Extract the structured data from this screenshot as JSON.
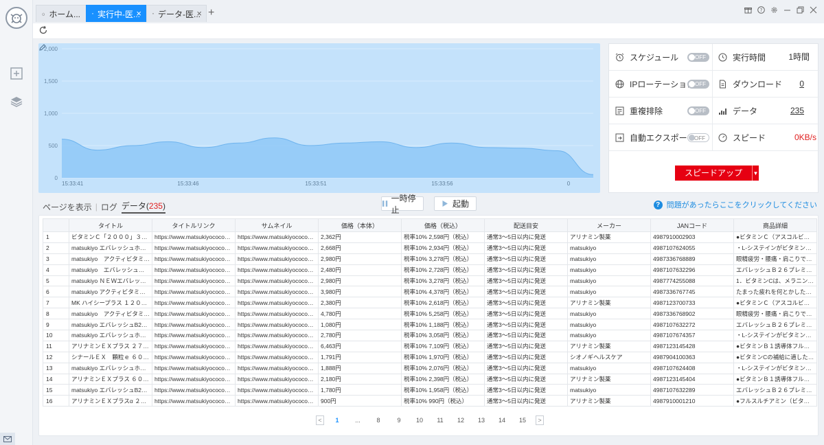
{
  "tabs": [
    {
      "label": "ホーム..."
    },
    {
      "label": "実行中-医..."
    },
    {
      "label": "データ-医..."
    }
  ],
  "chart_data": {
    "type": "area",
    "x": [
      "15:33:41",
      "15:33:46",
      "15:33:51",
      "15:33:56",
      "0"
    ],
    "ylim": [
      0,
      2000
    ],
    "yticks": [
      "2,000",
      "1,500",
      "1,000",
      "500",
      "0"
    ],
    "xticks": [
      "15:33:41",
      "15:33:46",
      "15:33:51",
      "15:33:56",
      "0"
    ],
    "values": [
      600,
      430,
      500,
      560,
      470,
      540,
      620,
      500,
      540,
      560,
      470,
      540,
      470,
      460,
      420,
      50
    ],
    "grid": true,
    "color": "#8cc7f7"
  },
  "stats": {
    "schedule": {
      "label": "スケジュール",
      "state": "OFF"
    },
    "runtime": {
      "label": "実行時間",
      "value": "1時間"
    },
    "ip_rotation": {
      "label": "IPローテーション",
      "state": "OFF"
    },
    "download": {
      "label": "ダウンロード",
      "value": "0"
    },
    "dedupe": {
      "label": "重複排除",
      "state": "OFF"
    },
    "data": {
      "label": "データ",
      "value": "235"
    },
    "auto_export": {
      "label": "自動エクスポート",
      "state": "OFF"
    },
    "speed": {
      "label": "スピード",
      "value": "0KB/s"
    },
    "speedup_label": "スピードアップ"
  },
  "data_tabs": {
    "show_page": "ページを表示",
    "log": "ログ",
    "data_label": "データ(",
    "data_count": "235",
    "data_close": ")"
  },
  "controls": {
    "pause": "一時停止",
    "start": "起動"
  },
  "help_text": "問題があったらここをクリックしてください",
  "table": {
    "headers": [
      "",
      "タイトル",
      "タイトルリンク",
      "サムネイル",
      "価格（本体）",
      "価格（税込）",
      "配送目安",
      "メーカー",
      "JANコード",
      "商品詳細"
    ],
    "rows": [
      [
        "1",
        "ビタミンＣ「２０００」３００...",
        "https://www.matsukiyococokara-...",
        "https://www.matsukiyococokara-...",
        "2,362円",
        "税率10% 2,598円（税込）",
        "通常3～5日以内に発送",
        "アリナミン製薬",
        "4987910002903",
        "●ビタミンＣ（アスコルビン酸..."
      ],
      [
        "2",
        "matsukiyo エバレッシュホワイ...",
        "https://www.matsukiyococokara-...",
        "https://www.matsukiyococokara-...",
        "2,668円",
        "税率10% 2,934円（税込）",
        "通常3～5日以内に発送",
        "matsukiyo",
        "4987107624055",
        "・L-システインがビタミンC、..."
      ],
      [
        "3",
        "matsukiyo　アクティビタミンＥ...",
        "https://www.matsukiyococokara-...",
        "https://www.matsukiyococokara-...",
        "2,980円",
        "税率10% 3,278円（税込）",
        "通常3～5日以内に発送",
        "matsukiyo",
        "4987336768889",
        "眼精疲労・腰痛・肩こりでお悩..."
      ],
      [
        "4",
        "matsukiyo　エバレッシュＢ２６...",
        "https://www.matsukiyococokara-...",
        "https://www.matsukiyococokara-...",
        "2,480円",
        "税率10% 2,728円（税込）",
        "通常3～5日以内に発送",
        "matsukiyo",
        "4987107632296",
        "エバレッシュＢ２６プレミアム..."
      ],
      [
        "5",
        "matsukiyo ＮＥＷエバレッシュ...",
        "https://www.matsukiyococokara-...",
        "https://www.matsukiyococokara-...",
        "2,980円",
        "税率10% 3,278円（税込）",
        "通常3～5日以内に発送",
        "matsukiyo",
        "4987774255088",
        "1．ビタミンCは、メラニンの生..."
      ],
      [
        "6",
        "matsukiyo アクティビタミンＧ...",
        "https://www.matsukiyococokara-...",
        "https://www.matsukiyococokara-...",
        "3,980円",
        "税率10% 4,378円（税込）",
        "通常3～5日以内に発送",
        "matsukiyo",
        "4987336767745",
        "たまった疲れを何とかしたい方..."
      ],
      [
        "7",
        "MK ハイシープラス １２０錠 ア...",
        "https://www.matsukiyococokara-...",
        "https://www.matsukiyococokara-...",
        "2,380円",
        "税率10% 2,618円（税込）",
        "通常3～5日以内に発送",
        "アリナミン製薬",
        "4987123700733",
        "●ビタミンＣ（アスコルビン酸）..."
      ],
      [
        "8",
        "matsukiyo　アクティビタミンＥ...",
        "https://www.matsukiyococokara-...",
        "https://www.matsukiyococokara-...",
        "4,780円",
        "税率10% 5,258円（税込）",
        "通常3～5日以内に発送",
        "matsukiyo",
        "4987336768902",
        "眼精疲労・腰痛・肩こりでお悩..."
      ],
      [
        "9",
        "matsukiyo エバレッシュB26プレ...",
        "https://www.matsukiyococokara-...",
        "https://www.matsukiyococokara-...",
        "1,080円",
        "税率10% 1,188円（税込）",
        "通常3～5日以内に発送",
        "matsukiyo",
        "4987107632272",
        "エバレッシュＢ２６プレミアム..."
      ],
      [
        "10",
        "matsukiyo エバレッシュホワイ...",
        "https://www.matsukiyococokara-...",
        "https://www.matsukiyococokara-...",
        "2,780円",
        "税率10% 3,058円（税込）",
        "通常3～5日以内に発送",
        "matsukiyo",
        "4987107674357",
        "・L-システインがビタミンC、..."
      ],
      [
        "11",
        "アリナミンＥＸプラス ２７０錠...",
        "https://www.matsukiyococokara-...",
        "https://www.matsukiyococokara-...",
        "6,463円",
        "税率10% 7,109円（税込）",
        "通常3～5日以内に発送",
        "アリナミン製薬",
        "4987123145428",
        "●ビタミンＢ１誘導体フルスル..."
      ],
      [
        "12",
        "シナールＥＸ　顆粒ｅ ６０包 シ...",
        "https://www.matsukiyococokara-...",
        "https://www.matsukiyococokara-...",
        "1,791円",
        "税率10% 1,970円（税込）",
        "通常3～5日以内に発送",
        "シオノギヘルスケア",
        "4987904100363",
        "●ビタミンCの補給に適したビ..."
      ],
      [
        "13",
        "matsukiyo エバレッシュホワイ...",
        "https://www.matsukiyococokara-...",
        "https://www.matsukiyococokara-...",
        "1,888円",
        "税率10% 2,076円（税込）",
        "通常3～5日以内に発送",
        "matsukiyo",
        "4987107624408",
        "・L-システインがビタミンC、..."
      ],
      [
        "14",
        "アリナミンＥＸプラス ６０錠 ア...",
        "https://www.matsukiyococokara-...",
        "https://www.matsukiyococokara-...",
        "2,180円",
        "税率10% 2,398円（税込）",
        "通常3～5日以内に発送",
        "アリナミン製薬",
        "4987123145404",
        "●ビタミンＢ１誘導体フルスル..."
      ],
      [
        "15",
        "matsukiyo エバレッシュB26プレ...",
        "https://www.matsukiyococokara-...",
        "https://www.matsukiyococokara-...",
        "1,780円",
        "税率10% 1,958円（税込）",
        "通常3～5日以内に発送",
        "matsukiyo",
        "4987107632289",
        "エバレッシュＢ２６プレミアム..."
      ],
      [
        "16",
        "アリナミンＥＸプラスα ２４錠...",
        "https://www.matsukiyococokara-...",
        "https://www.matsukiyococokara-...",
        "900円",
        "税率10% 990円（税込）",
        "通常3～5日以内に発送",
        "アリナミン製薬",
        "4987910001210",
        "●フルスルチアミン（ビタミン..."
      ]
    ]
  },
  "pagination": {
    "pages": [
      "1",
      "...",
      "8",
      "9",
      "10",
      "11",
      "12",
      "13",
      "14",
      "15"
    ],
    "current": "1",
    "prev": "<",
    "next": ">"
  }
}
